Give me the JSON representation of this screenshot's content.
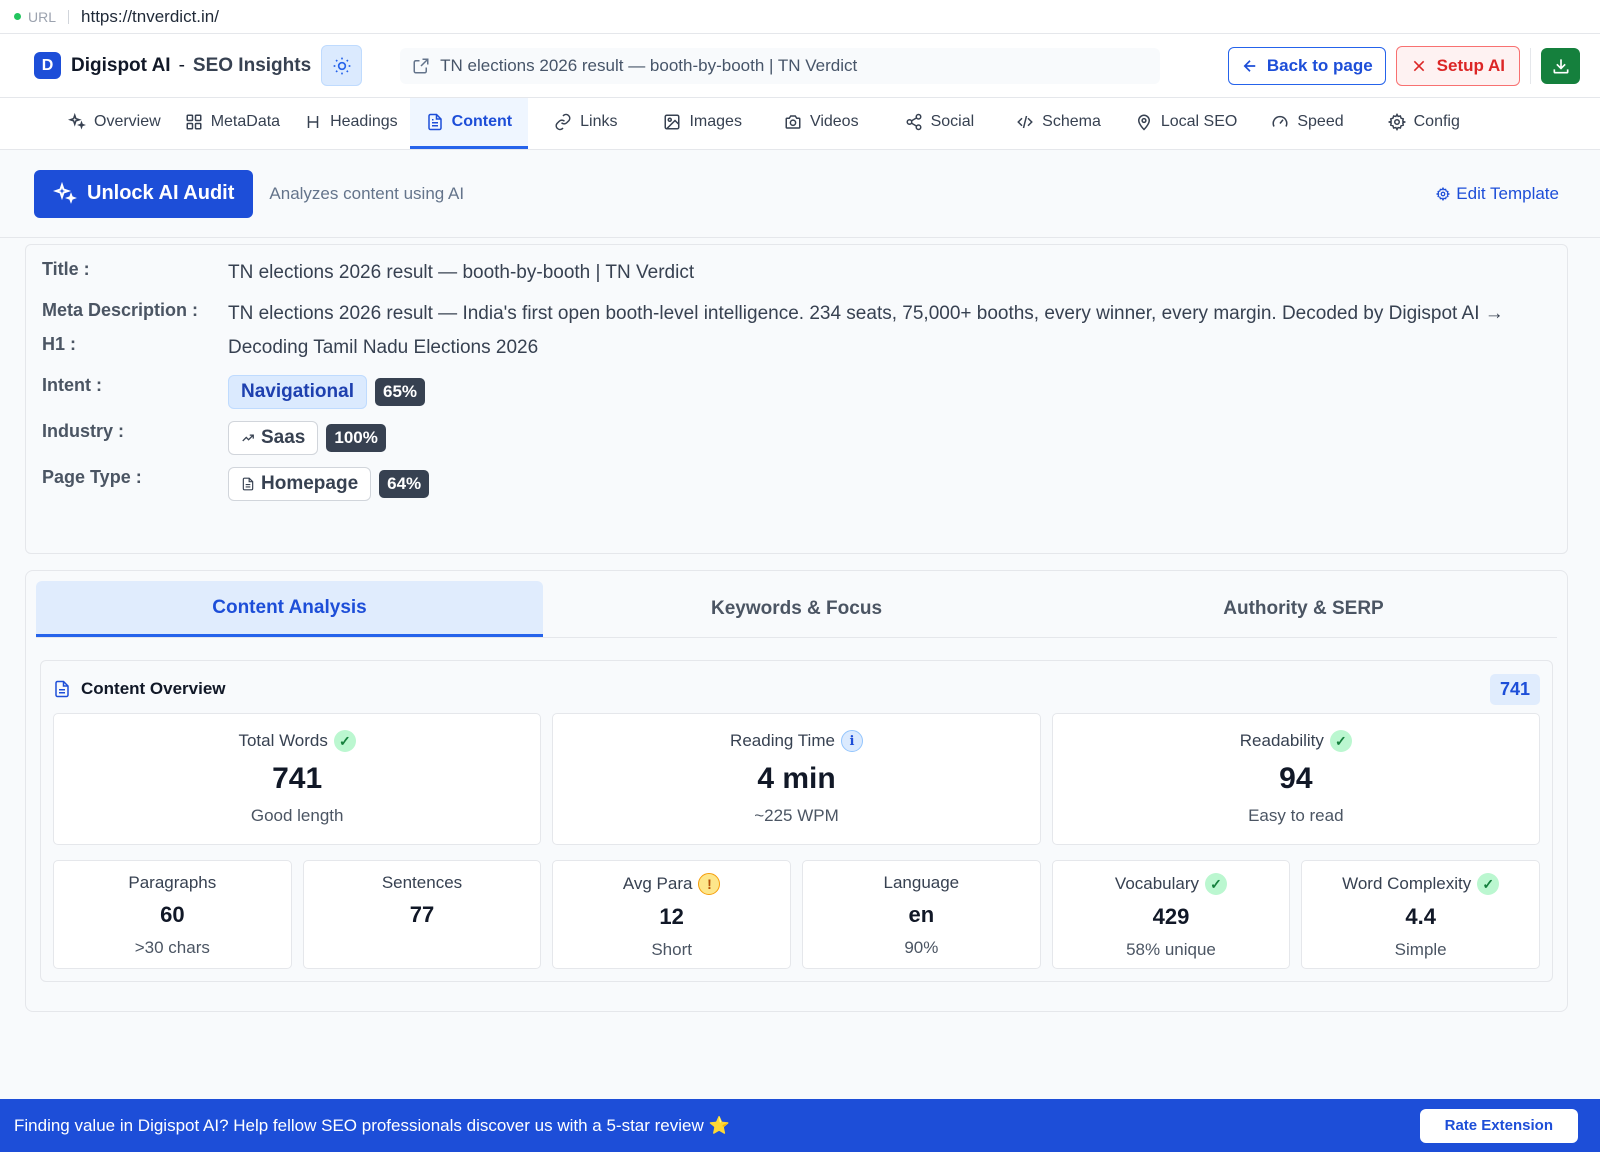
{
  "urlbar": {
    "label": "URL",
    "url": "https://tnverdict.in/"
  },
  "header": {
    "logo_letter": "D",
    "brand": "Digispot AI",
    "separator": "-",
    "subtitle": "SEO Insights",
    "page_title": "TN elections 2026 result — booth-by-booth | TN Verdict",
    "back_label": "Back to page",
    "setup_label": "Setup AI"
  },
  "nav": {
    "tabs": [
      {
        "label": "Overview",
        "icon": "sparkles-icon"
      },
      {
        "label": "MetaData",
        "icon": "grid-icon"
      },
      {
        "label": "Headings",
        "icon": "heading-icon"
      },
      {
        "label": "Content",
        "icon": "document-icon"
      },
      {
        "label": "Links",
        "icon": "link-icon"
      },
      {
        "label": "Images",
        "icon": "image-icon"
      },
      {
        "label": "Videos",
        "icon": "camera-icon"
      },
      {
        "label": "Social",
        "icon": "share-icon"
      },
      {
        "label": "Schema",
        "icon": "code-icon"
      },
      {
        "label": "Local SEO",
        "icon": "map-pin-icon"
      },
      {
        "label": "Speed",
        "icon": "gauge-icon"
      },
      {
        "label": "Config",
        "icon": "gear-icon"
      }
    ],
    "active": "Content"
  },
  "toolbar": {
    "unlock_label": "Unlock AI Audit",
    "description": "Analyzes content using AI",
    "edit_template_label": "Edit Template"
  },
  "meta": {
    "title_key": "Title :",
    "title": "TN elections 2026 result — booth-by-booth | TN Verdict",
    "description_key": "Meta Description :",
    "description": "TN elections 2026 result — India's first open booth-level intelligence. 234 seats, 75,000+ booths, every winner, every margin. Decoded by Digispot AI →",
    "h1_key": "H1 :",
    "h1": "Decoding Tamil Nadu Elections 2026",
    "intent_key": "Intent :",
    "intent": "Navigational",
    "intent_pct": "65%",
    "industry_key": "Industry :",
    "industry": "Saas",
    "industry_pct": "100%",
    "pagetype_key": "Page Type :",
    "pagetype": "Homepage",
    "pagetype_pct": "64%"
  },
  "subtabs": [
    "Content Analysis",
    "Keywords & Focus",
    "Authority & SERP"
  ],
  "overview": {
    "title": "Content Overview",
    "count": "741",
    "main_cards": [
      {
        "label": "Total Words",
        "value": "741",
        "sub": "Good length",
        "status": "ok"
      },
      {
        "label": "Reading Time",
        "value": "4 min",
        "sub": "~225 WPM",
        "status": "info"
      },
      {
        "label": "Readability",
        "value": "94",
        "sub": "Easy to read",
        "status": "ok"
      }
    ],
    "small_cards": [
      {
        "label": "Paragraphs",
        "value": "60",
        "sub": ">30 chars",
        "status": ""
      },
      {
        "label": "Sentences",
        "value": "77",
        "sub": "",
        "status": ""
      },
      {
        "label": "Avg Para",
        "value": "12",
        "sub": "Short",
        "status": "warn"
      },
      {
        "label": "Language",
        "value": "en",
        "sub": "90%",
        "status": ""
      },
      {
        "label": "Vocabulary",
        "value": "429",
        "sub": "58% unique",
        "status": "ok"
      },
      {
        "label": "Word Complexity",
        "value": "4.4",
        "sub": "Simple",
        "status": "ok"
      }
    ]
  },
  "footer": {
    "message": "Finding value in Digispot AI? Help fellow SEO professionals discover us with a 5-star review ⭐",
    "rate_label": "Rate Extension"
  },
  "colors": {
    "accent": "#1d4ed8",
    "success": "#15803d",
    "danger": "#dc2626",
    "warning": "#f59e0b"
  }
}
